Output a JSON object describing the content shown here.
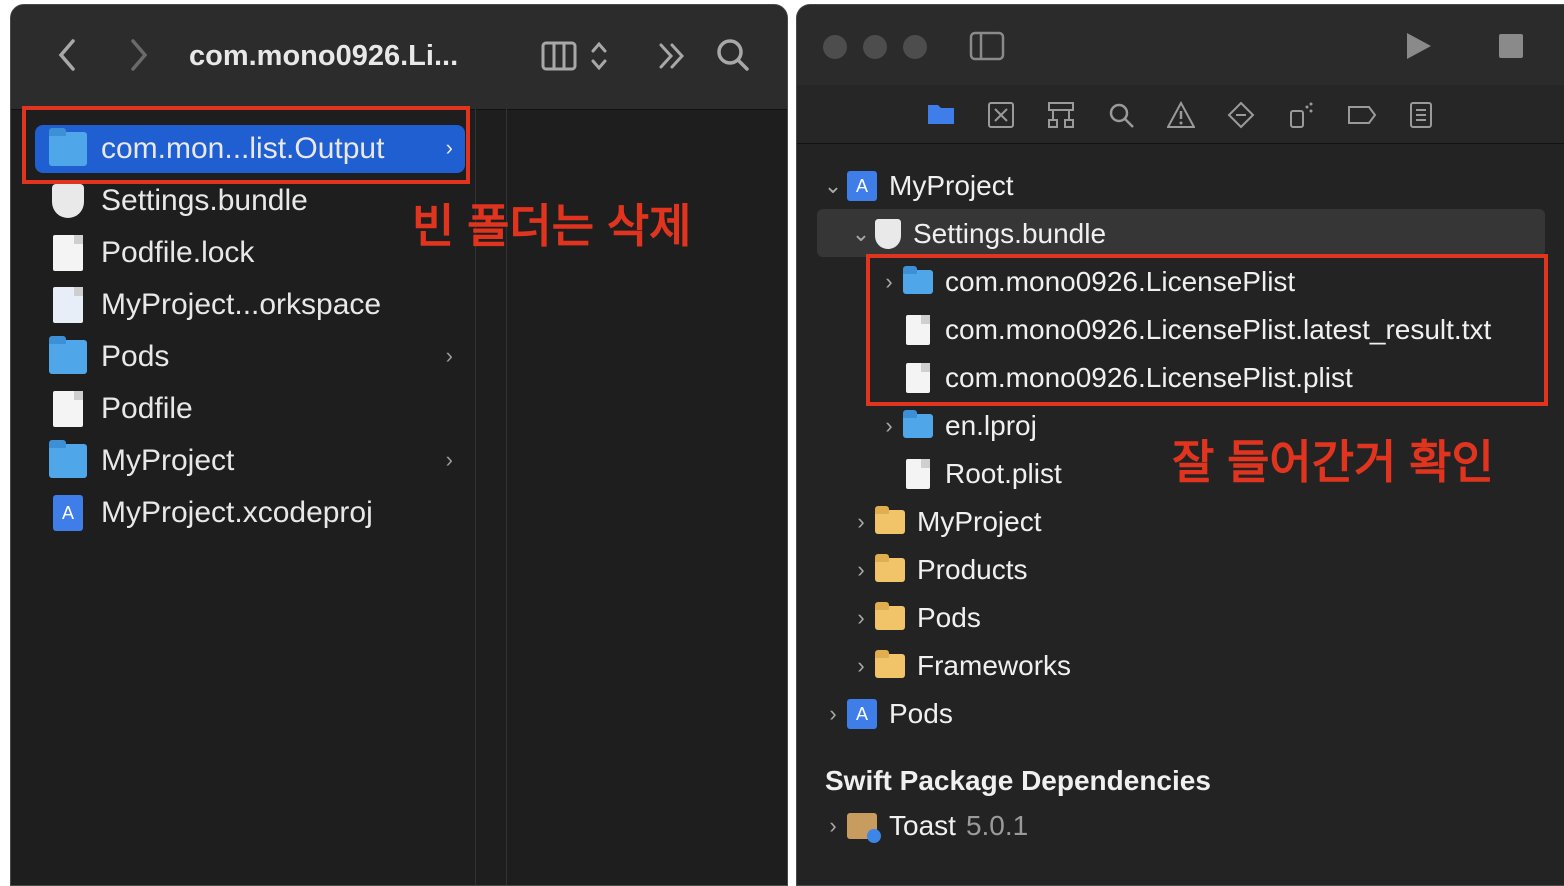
{
  "finder": {
    "toolbar": {
      "back_icon": "chevron-left",
      "forward_icon": "chevron-right",
      "title": "com.mono0926.Li...",
      "view_icon": "column-view",
      "more_icon": "double-chevron-right",
      "search_icon": "magnifier"
    },
    "items": [
      {
        "label": "com.mon...list.Output",
        "icon": "folder-blue",
        "selected": true,
        "has_children": true
      },
      {
        "label": "Settings.bundle",
        "icon": "shield"
      },
      {
        "label": "Podfile.lock",
        "icon": "document"
      },
      {
        "label": "MyProject...orkspace",
        "icon": "workspace"
      },
      {
        "label": "Pods",
        "icon": "folder-blue",
        "has_children": true
      },
      {
        "label": "Podfile",
        "icon": "document"
      },
      {
        "label": "MyProject",
        "icon": "folder-blue",
        "has_children": true
      },
      {
        "label": "MyProject.xcodeproj",
        "icon": "xcodeproj"
      }
    ]
  },
  "xcode": {
    "toolbar": {
      "sidebar_icon": "sidebar-toggle",
      "run_icon": "play",
      "stop_icon": "stop"
    },
    "navigator_icons": [
      "folder",
      "source-control",
      "hierarchy",
      "search",
      "warning",
      "test",
      "debug",
      "breakpoint",
      "report"
    ],
    "tree": [
      {
        "label": "MyProject",
        "icon": "xcodeproj",
        "expanded": true
      },
      {
        "label": "Settings.bundle",
        "icon": "shield",
        "expanded": true
      },
      {
        "label": "com.mono0926.LicensePlist",
        "icon": "folder-blue",
        "collapsed": true
      },
      {
        "label": "com.mono0926.LicensePlist.latest_result.txt",
        "icon": "text-file"
      },
      {
        "label": "com.mono0926.LicensePlist.plist",
        "icon": "plist-file"
      },
      {
        "label": "en.lproj",
        "icon": "folder-blue",
        "collapsed": true
      },
      {
        "label": "Root.plist",
        "icon": "plist-file"
      },
      {
        "label": "MyProject",
        "icon": "folder-yellow",
        "collapsed": true
      },
      {
        "label": "Products",
        "icon": "folder-yellow",
        "collapsed": true
      },
      {
        "label": "Pods",
        "icon": "folder-yellow",
        "collapsed": true
      },
      {
        "label": "Frameworks",
        "icon": "folder-yellow",
        "collapsed": true
      },
      {
        "label": "Pods",
        "icon": "xcodeproj",
        "collapsed": true
      }
    ],
    "packages_title": "Swift Package Dependencies",
    "packages": [
      {
        "name": "Toast",
        "version": "5.0.1"
      }
    ]
  },
  "annotations": {
    "delete_note": "빈 폴더는 삭제",
    "confirm_note": "잘 들어간거 확인",
    "color": "#e0341f"
  }
}
